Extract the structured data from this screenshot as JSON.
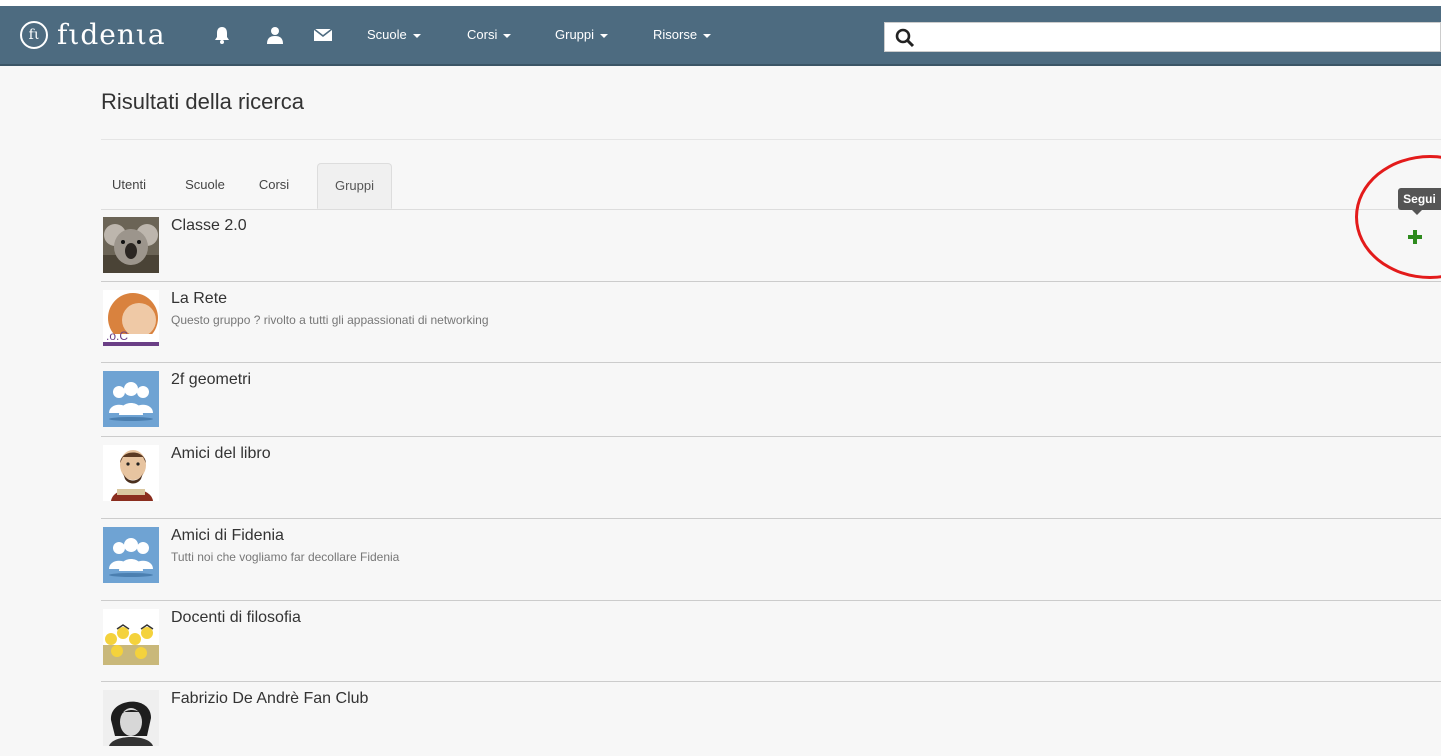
{
  "brand": {
    "logo_mark": "fι",
    "name": "fιdenιa"
  },
  "navbar": {
    "icons": [
      "bell-icon",
      "user-icon",
      "envelope-icon"
    ],
    "menus": [
      "Scuole",
      "Corsi",
      "Gruppi",
      "Risorse"
    ],
    "search": {
      "value": "",
      "placeholder": ""
    },
    "colors": {
      "navbar_bg": "#4d6b80",
      "follow_green": "#2e8b1e",
      "highlight_red": "#e31b1b"
    }
  },
  "main": {
    "title": "Risultati della ricerca",
    "tabs": [
      {
        "label": "Utenti",
        "active": false
      },
      {
        "label": "Scuole",
        "active": false
      },
      {
        "label": "Corsi",
        "active": false
      },
      {
        "label": "Gruppi",
        "active": true
      }
    ],
    "groups": [
      {
        "name": "Classe 2.0",
        "description": "",
        "thumb": "koala-photo"
      },
      {
        "name": "La Rete",
        "description": "Questo gruppo ? rivolto a tutti gli appassionati di networking",
        "thumb": "network-logo"
      },
      {
        "name": "2f geometri",
        "description": "",
        "thumb": "group-icon"
      },
      {
        "name": "Amici del libro",
        "description": "",
        "thumb": "writer-caricature"
      },
      {
        "name": "Amici di Fidenia",
        "description": "Tutti noi che vogliamo far decollare Fidenia",
        "thumb": "group-icon"
      },
      {
        "name": "Docenti di filosofia",
        "description": "",
        "thumb": "cartoon-philosophers"
      },
      {
        "name": "Fabrizio De Andrè Fan Club",
        "description": "",
        "thumb": "portrait-photo"
      }
    ],
    "follow": {
      "tooltip": "Segui",
      "icon": "plus-icon"
    }
  }
}
